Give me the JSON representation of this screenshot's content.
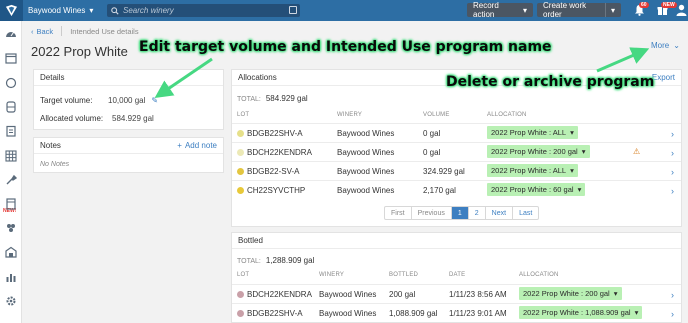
{
  "topbar": {
    "winery": "Baywood Wines",
    "search_placeholder": "Search winery",
    "record_action": "Record action",
    "create_work_order": "Create work order",
    "notif_badge": "60",
    "new_badge": "NEW"
  },
  "sidebar": {
    "new_label": "NEW!"
  },
  "breadcrumb": {
    "back": "Back",
    "current": "Intended Use details"
  },
  "page": {
    "title": "2022 Prop White",
    "more": "More"
  },
  "annotations": {
    "edit": "Edit target volume and Intended Use program name",
    "delete": "Delete or archive program"
  },
  "details": {
    "header": "Details",
    "target_label": "Target volume:",
    "target_value": "10,000 gal",
    "allocated_label": "Allocated volume:",
    "allocated_value": "584.929 gal"
  },
  "notes": {
    "header": "Notes",
    "add": "Add note",
    "empty": "No Notes"
  },
  "allocations": {
    "header": "Allocations",
    "export": "Export",
    "total_label": "TOTAL:",
    "total_value": "584.929 gal",
    "columns": [
      "LOT",
      "WINERY",
      "VOLUME",
      "ALLOCATION"
    ],
    "rows": [
      {
        "lot": "BDGB22SHV-A",
        "winery": "Baywood Wines",
        "volume": "0 gal",
        "allocation": "2022 Prop White : ALL",
        "dot": "#e6e08a"
      },
      {
        "lot": "BDCH22KENDRA",
        "winery": "Baywood Wines",
        "volume": "0 gal",
        "allocation": "2022 Prop White : 200 gal",
        "dot": "#ece9b6"
      },
      {
        "lot": "BDGB22-SV-A",
        "winery": "Baywood Wines",
        "volume": "324.929 gal",
        "allocation": "2022 Prop White : ALL",
        "dot": "#e3c640"
      },
      {
        "lot": "CH22SYVCTHP",
        "winery": "Baywood Wines",
        "volume": "2,170 gal",
        "allocation": "2022 Prop White : 60 gal",
        "dot": "#e8c93a"
      }
    ],
    "pagination": {
      "first": "First",
      "prev": "Previous",
      "p1": "1",
      "p2": "2",
      "next": "Next",
      "last": "Last"
    }
  },
  "bottled": {
    "header": "Bottled",
    "total_label": "TOTAL:",
    "total_value": "1,288.909 gal",
    "columns": [
      "LOT",
      "WINERY",
      "BOTTLED",
      "DATE",
      "ALLOCATION"
    ],
    "rows": [
      {
        "lot": "BDCH22KENDRA",
        "winery": "Baywood Wines",
        "bottled": "200 gal",
        "date": "1/11/23 8:56 AM",
        "allocation": "2022 Prop White : 200 gal",
        "dot": "#c9a0a8"
      },
      {
        "lot": "BDGB22SHV-A",
        "winery": "Baywood Wines",
        "bottled": "1,088.909 gal",
        "date": "1/11/23 9:01 AM",
        "allocation": "2022 Prop White : 1,088.909 gal",
        "dot": "#c9a0a8"
      }
    ]
  },
  "colors": {
    "brand": "#2d6ea4",
    "link": "#3d7fc1",
    "pill": "#b9f0b4",
    "annotation_glow": "#39e07a"
  }
}
